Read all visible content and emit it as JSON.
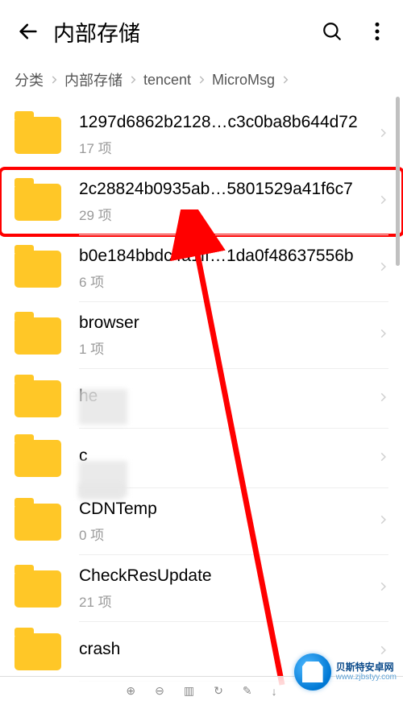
{
  "header": {
    "title": "内部存储"
  },
  "breadcrumb": {
    "segments": [
      "分类",
      "内部存储",
      "tencent",
      "MicroMsg"
    ]
  },
  "list": {
    "items": [
      {
        "name": "1297d6862b2128…c3c0ba8b644d72",
        "meta": "17 项",
        "highlight": false
      },
      {
        "name": "2c28824b0935ab…5801529a41f6c7",
        "meta": "29 项",
        "highlight": true
      },
      {
        "name": "b0e184bbdc4a1ff…1da0f48637556b",
        "meta": "6 项",
        "highlight": false
      },
      {
        "name": "browser",
        "meta": "1 项",
        "highlight": false
      },
      {
        "name": "     he",
        "meta": " ",
        "highlight": false
      },
      {
        "name": "c",
        "meta": " ",
        "highlight": false
      },
      {
        "name": "CDNTemp",
        "meta": "0 项",
        "highlight": false
      },
      {
        "name": "CheckResUpdate",
        "meta": "21 项",
        "highlight": false
      },
      {
        "name": "crash",
        "meta": "",
        "highlight": false
      }
    ]
  },
  "watermark": {
    "line1": "贝斯特安卓网",
    "line2": "www.zjbstyy.com"
  }
}
